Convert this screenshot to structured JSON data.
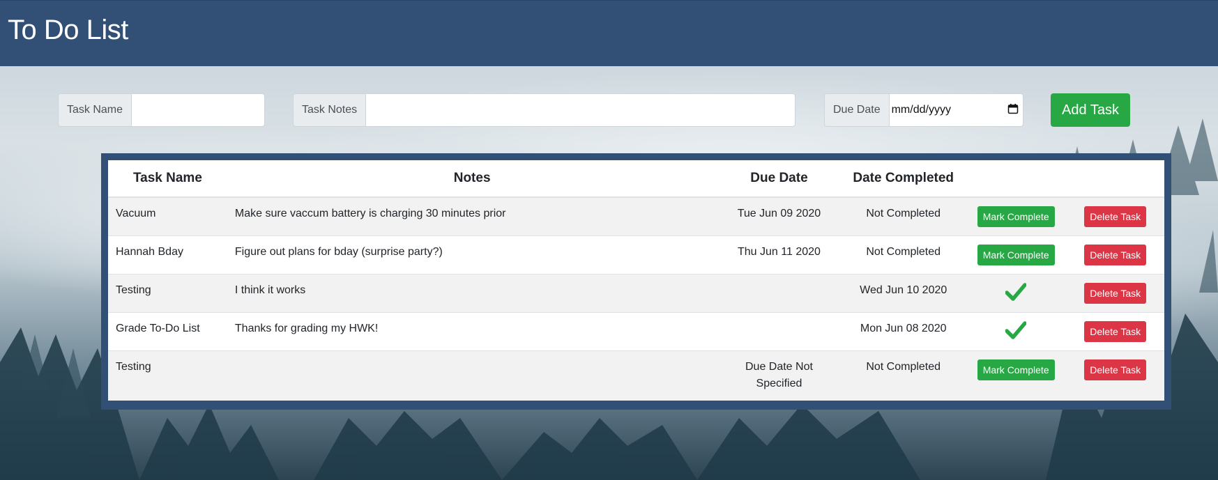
{
  "header": {
    "title": "To Do List"
  },
  "form": {
    "task_name_label": "Task Name",
    "task_name_value": "",
    "task_notes_label": "Task Notes",
    "task_notes_value": "",
    "due_date_label": "Due Date",
    "due_date_placeholder": "mm/dd/yyyy",
    "add_button_label": "Add Task"
  },
  "table": {
    "columns": [
      "Task Name",
      "Notes",
      "Due Date",
      "Date Completed",
      "",
      ""
    ],
    "rows": [
      {
        "name": "Vacuum",
        "notes": "Make sure vaccum battery is charging 30 minutes prior",
        "due": "Tue Jun 09 2020",
        "completed": "Not Completed",
        "done": false,
        "mark_label": "Mark Complete",
        "delete_label": "Delete Task"
      },
      {
        "name": "Hannah Bday",
        "notes": "Figure out plans for bday (surprise party?)",
        "due": "Thu Jun 11 2020",
        "completed": "Not Completed",
        "done": false,
        "mark_label": "Mark Complete",
        "delete_label": "Delete Task"
      },
      {
        "name": "Testing",
        "notes": "I think it works",
        "due": "",
        "completed": "Wed Jun 10 2020",
        "done": true,
        "mark_label": "",
        "delete_label": "Delete Task"
      },
      {
        "name": "Grade To-Do List",
        "notes": "Thanks for grading my HWK!",
        "due": "",
        "completed": "Mon Jun 08 2020",
        "done": true,
        "mark_label": "",
        "delete_label": "Delete Task"
      },
      {
        "name": "Testing",
        "notes": "",
        "due": "Due Date Not Specified",
        "completed": "Not Completed",
        "done": false,
        "mark_label": "Mark Complete",
        "delete_label": "Delete Task"
      }
    ]
  },
  "icons": {
    "calendar": "calendar-icon",
    "check": "checkmark-icon"
  },
  "colors": {
    "header": "#325076",
    "success": "#28a745",
    "danger": "#dc3545"
  }
}
